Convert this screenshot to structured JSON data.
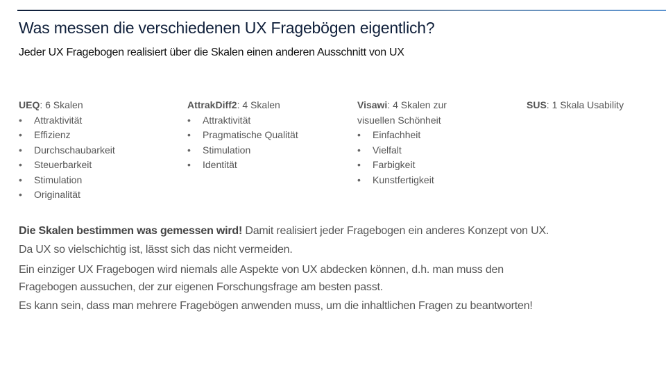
{
  "title": "Was messen die verschiedenen UX Fragebögen eigentlich?",
  "subtitle": "Jeder UX Fragebogen realisiert über die Skalen einen anderen Ausschnitt von UX",
  "accent_colors": {
    "rule_start": "#0f1f3a",
    "rule_end": "#5b93d0",
    "title": "#0f1f3a",
    "body": "#555555"
  },
  "questionnaires": [
    {
      "name": "UEQ",
      "description": ": 6 Skalen",
      "scales": [
        "Attraktivität",
        "Effizienz",
        "Durchschaubarkeit",
        "Steuerbarkeit",
        "Stimulation",
        "Originalität"
      ]
    },
    {
      "name": "AttrakDiff2",
      "description": ": 4 Skalen",
      "scales": [
        "Attraktivität",
        "Pragmatische Qualität",
        "Stimulation",
        "Identität"
      ]
    },
    {
      "name": "Visawi",
      "description": ": 4 Skalen zur",
      "description_line2": "visuellen Schönheit",
      "scales": [
        "Einfachheit",
        "Vielfalt",
        "Farbigkeit",
        "Kunstfertigkeit"
      ]
    },
    {
      "name": "SUS",
      "description": ": 1 Skala Usability",
      "scales": []
    }
  ],
  "body": {
    "p1_bold": "Die Skalen bestimmen was gemessen wird!",
    "p1_rest": " Damit realisiert jeder Fragebogen ein anderes Konzept von UX.",
    "p2": "Da UX so vielschichtig ist, lässt sich das nicht vermeiden.",
    "p3_line1": "Ein einziger UX Fragebogen wird niemals alle Aspekte von UX abdecken können, d.h. man muss den",
    "p3_line2": "Fragebogen aussuchen, der zur eigenen Forschungsfrage am besten passt.",
    "p4": "Es kann sein, dass man mehrere Fragebögen anwenden muss, um die inhaltlichen Fragen zu beantworten!"
  }
}
